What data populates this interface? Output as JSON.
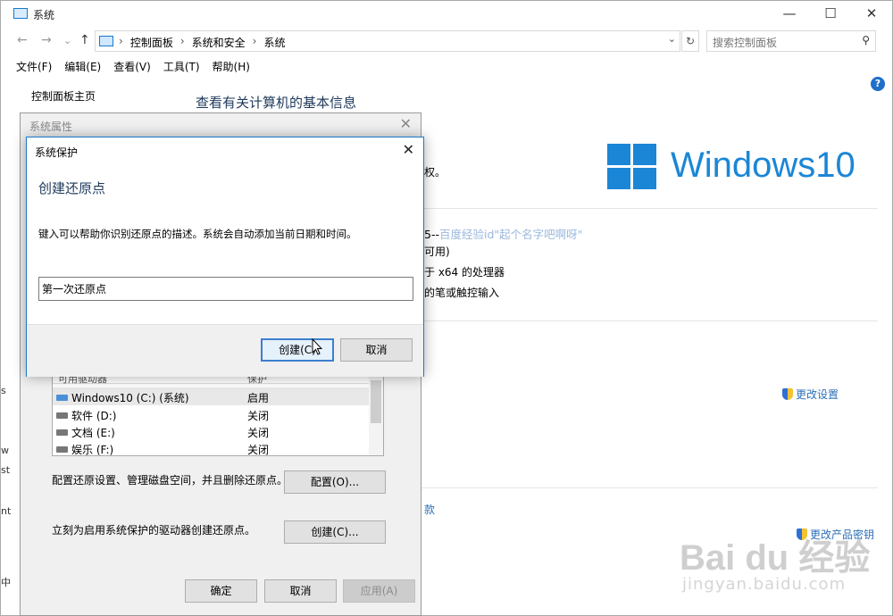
{
  "window": {
    "title": "系统",
    "min": "—",
    "max": "☐",
    "close": "✕"
  },
  "nav": {
    "back": "←",
    "forward": "→",
    "dropdown": "⌄",
    "up": "↑"
  },
  "address": {
    "crumbs": [
      "控制面板",
      "系统和安全",
      "系统"
    ],
    "separator": "›",
    "dropdown": "⌄",
    "refresh": "↻"
  },
  "search": {
    "placeholder": "搜索控制面板"
  },
  "menu": [
    "文件(F)",
    "编辑(E)",
    "查看(V)",
    "工具(T)",
    "帮助(H)"
  ],
  "sidebar": {
    "home": "控制面板主页"
  },
  "main": {
    "heading": "查看有关计算机的基本信息",
    "help": "?",
    "windows_logo_text": "Windows10",
    "fragments": {
      "f1": "权。",
      "f2": "5--",
      "f2link": "百度经验id\"起个名字吧啊呀\"",
      "f3": "可用)",
      "f4": "于 x64 的处理器",
      "f5": "的笔或触控输入",
      "f6": "款"
    },
    "change_settings": "更改设置",
    "change_product_key": "更改产品密钥"
  },
  "watermark": {
    "text": "Bai du 经验",
    "sub": "jingyan.baidu.com"
  },
  "system_properties": {
    "title": "系统属性",
    "close": "✕",
    "drive_header": "可用驱动器",
    "drive_header2": "保护",
    "drives": [
      {
        "name": "Windows10 (C:) (系统)",
        "state": "启用"
      },
      {
        "name": "软件 (D:)",
        "state": "关闭"
      },
      {
        "name": "文档 (E:)",
        "state": "关闭"
      },
      {
        "name": "娱乐 (F:)",
        "state": "关闭"
      }
    ],
    "configure_text": "配置还原设置、管理磁盘空间，并且删除还原点。",
    "configure_btn": "配置(O)...",
    "create_text": "立刻为启用系统保护的驱动器创建还原点。",
    "create_btn": "创建(C)...",
    "ok": "确定",
    "cancel": "取消",
    "apply": "应用(A)"
  },
  "dialog": {
    "title": "系统保护",
    "close": "✕",
    "heading": "创建还原点",
    "description": "键入可以帮助你识别还原点的描述。系统会自动添加当前日期和时间。",
    "input_value": "第一次还原点",
    "create_btn": "创建(C)",
    "cancel_btn": "取消"
  },
  "left_strip": [
    "s",
    "w",
    "st",
    "nt",
    "中"
  ]
}
